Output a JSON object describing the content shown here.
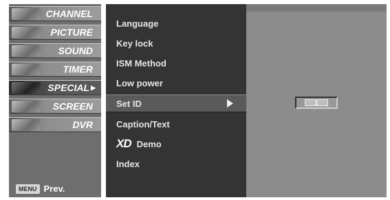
{
  "main_menu": {
    "items": [
      {
        "label": "CHANNEL",
        "icon": "channel-icon",
        "active": false
      },
      {
        "label": "PICTURE",
        "icon": "picture-icon",
        "active": false
      },
      {
        "label": "SOUND",
        "icon": "sound-icon",
        "active": false
      },
      {
        "label": "TIMER",
        "icon": "timer-icon",
        "active": false
      },
      {
        "label": "SPECIAL",
        "icon": "special-icon",
        "active": true
      },
      {
        "label": "SCREEN",
        "icon": "screen-icon",
        "active": false
      },
      {
        "label": "DVR",
        "icon": "dvr-icon",
        "active": false
      }
    ],
    "footer": {
      "key_label": "MENU",
      "label": "Prev."
    }
  },
  "sub_menu": {
    "items": [
      {
        "label": "Language"
      },
      {
        "label": "Key lock"
      },
      {
        "label": "ISM Method"
      },
      {
        "label": "Low power"
      },
      {
        "label": "Set ID",
        "active": true
      },
      {
        "label": "Caption/Text"
      },
      {
        "label": "Demo",
        "prefix": "XD"
      },
      {
        "label": "Index"
      }
    ]
  },
  "value_panel": {
    "value": "1"
  },
  "colors": {
    "main_menu_bg": "#6e6e6e",
    "sub_menu_bg": "#343434",
    "value_panel_bg": "#8c8c8c",
    "highlight": "#5a5a5a"
  }
}
